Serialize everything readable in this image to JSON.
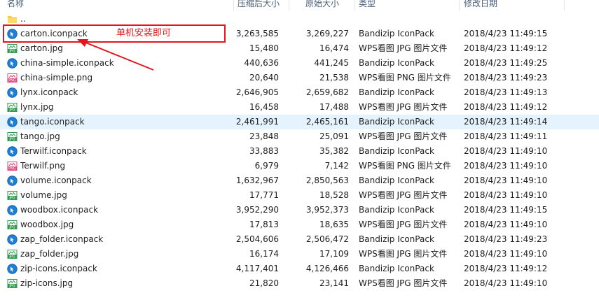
{
  "columns": {
    "name": "名称",
    "compressed": "压缩后大小",
    "original": "原始大小",
    "type": "类型",
    "modified": "修改日期"
  },
  "parent": {
    "name": "..",
    "icon": "folder-icon"
  },
  "files": [
    {
      "name": "carton.iconpack",
      "compressed": "3,263,585",
      "original": "3,269,227",
      "type": "Bandizip IconPack",
      "modified": "2018/4/23 11:49:15",
      "icon": "iconpack-icon"
    },
    {
      "name": "carton.jpg",
      "compressed": "15,480",
      "original": "16,474",
      "type": "WPS看图 JPG 图片文件",
      "modified": "2018/4/23 11:49:12",
      "icon": "jpg-icon"
    },
    {
      "name": "china-simple.iconpack",
      "compressed": "440,636",
      "original": "441,245",
      "type": "Bandizip IconPack",
      "modified": "2018/4/23 11:49:25",
      "icon": "iconpack-icon"
    },
    {
      "name": "china-simple.png",
      "compressed": "20,640",
      "original": "21,538",
      "type": "WPS看图 PNG 图片文件",
      "modified": "2018/4/23 11:49:23",
      "icon": "png-icon"
    },
    {
      "name": "lynx.iconpack",
      "compressed": "2,646,905",
      "original": "2,659,682",
      "type": "Bandizip IconPack",
      "modified": "2018/4/23 11:49:13",
      "icon": "iconpack-icon"
    },
    {
      "name": "lynx.jpg",
      "compressed": "16,458",
      "original": "17,488",
      "type": "WPS看图 JPG 图片文件",
      "modified": "2018/4/23 11:49:12",
      "icon": "jpg-icon"
    },
    {
      "name": "tango.iconpack",
      "compressed": "2,461,991",
      "original": "2,465,161",
      "type": "Bandizip IconPack",
      "modified": "2018/4/23 11:49:14",
      "icon": "iconpack-icon",
      "selected": true
    },
    {
      "name": "tango.jpg",
      "compressed": "23,848",
      "original": "25,091",
      "type": "WPS看图 JPG 图片文件",
      "modified": "2018/4/23 11:49:11",
      "icon": "jpg-icon"
    },
    {
      "name": "Terwilf.iconpack",
      "compressed": "33,883",
      "original": "35,382",
      "type": "Bandizip IconPack",
      "modified": "2018/4/23 11:49:10",
      "icon": "iconpack-icon"
    },
    {
      "name": "Terwilf.png",
      "compressed": "6,979",
      "original": "7,142",
      "type": "WPS看图 PNG 图片文件",
      "modified": "2018/4/23 11:49:10",
      "icon": "png-icon"
    },
    {
      "name": "volume.iconpack",
      "compressed": "1,632,967",
      "original": "2,850,563",
      "type": "Bandizip IconPack",
      "modified": "2018/4/23 11:49:10",
      "icon": "iconpack-icon"
    },
    {
      "name": "volume.jpg",
      "compressed": "17,771",
      "original": "18,528",
      "type": "WPS看图 JPG 图片文件",
      "modified": "2018/4/23 11:49:10",
      "icon": "jpg-icon"
    },
    {
      "name": "woodbox.iconpack",
      "compressed": "3,952,290",
      "original": "3,952,373",
      "type": "Bandizip IconPack",
      "modified": "2018/4/23 11:49:15",
      "icon": "iconpack-icon"
    },
    {
      "name": "woodbox.jpg",
      "compressed": "17,813",
      "original": "18,635",
      "type": "WPS看图 JPG 图片文件",
      "modified": "2018/4/23 11:49:10",
      "icon": "jpg-icon"
    },
    {
      "name": "zap_folder.iconpack",
      "compressed": "2,504,606",
      "original": "2,506,472",
      "type": "Bandizip IconPack",
      "modified": "2018/4/23 11:49:23",
      "icon": "iconpack-icon"
    },
    {
      "name": "zap_folder.jpg",
      "compressed": "16,174",
      "original": "17,109",
      "type": "WPS看图 JPG 图片文件",
      "modified": "2018/4/23 11:49:10",
      "icon": "jpg-icon"
    },
    {
      "name": "zip-icons.iconpack",
      "compressed": "4,117,401",
      "original": "4,126,466",
      "type": "Bandizip IconPack",
      "modified": "2018/4/23 11:49:12",
      "icon": "iconpack-icon"
    },
    {
      "name": "zip-icons.jpg",
      "compressed": "21,820",
      "original": "23,141",
      "type": "WPS看图 JPG 图片文件",
      "modified": "2018/4/23 11:49:10",
      "icon": "jpg-icon"
    }
  ],
  "annotation": {
    "text": "单机安装即可",
    "color": "#e6141c"
  },
  "colors": {
    "selected_row": "#e5f3ff",
    "header_text": "#4c607a",
    "iconpack_blue": "#1e7fd6",
    "jpg_green": "#2e9a4e",
    "png_pink": "#d9447a"
  }
}
